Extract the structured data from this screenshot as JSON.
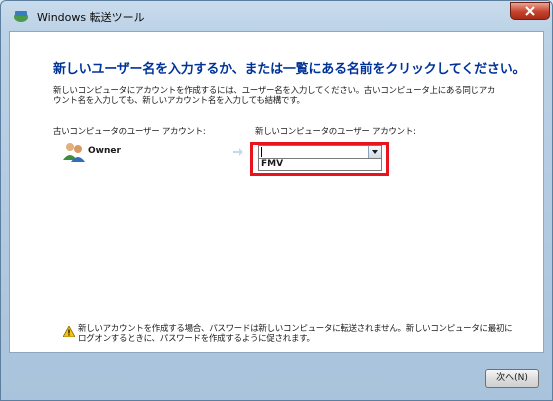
{
  "window": {
    "title": "Windows 転送ツール"
  },
  "main": {
    "heading": "新しいユーザー名を入力するか、または一覧にある名前をクリックしてください。",
    "description": "新しいコンピュータにアカウントを作成するには、ユーザー名を入力してください。古いコンピュータ上にある同じアカウント名を入力しても、新しいアカウント名を入力しても結構です。",
    "old_label": "古いコンピュータのユーザー アカウント:",
    "new_label": "新しいコンピュータのユーザー アカウント:",
    "old_user": "Owner",
    "combo_value": "",
    "options": [
      "FMV"
    ],
    "note": "新しいアカウントを作成する場合、パスワードは新しいコンピュータに転送されません。新しいコンピュータに最初にログオンするときに、パスワードを作成するように促されます。"
  },
  "footer": {
    "next_label": "次へ(N)"
  },
  "colors": {
    "heading": "#003399",
    "highlight": "#e8141b"
  },
  "icons": [
    "app-icon",
    "close-icon",
    "users-icon",
    "arrow-right-icon",
    "chevron-down-icon",
    "warning-icon"
  ]
}
